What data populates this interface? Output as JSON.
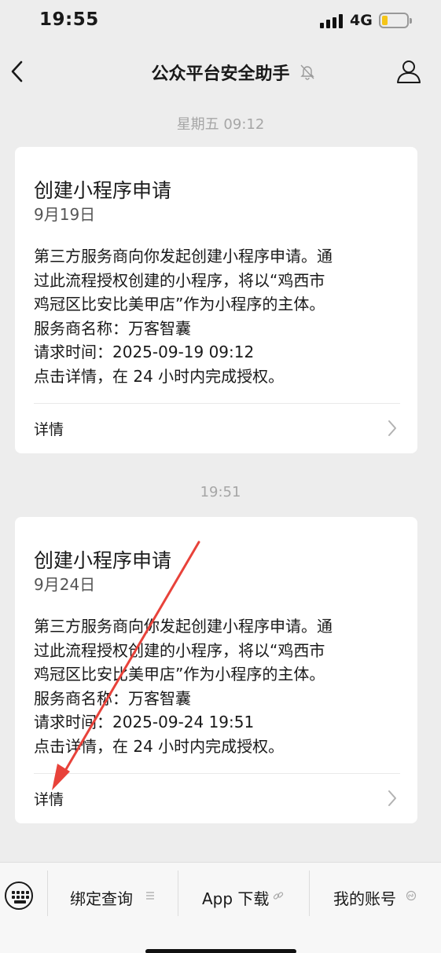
{
  "status_bar": {
    "time": "19:55",
    "network": "4G"
  },
  "nav": {
    "title": "公众平台安全助手"
  },
  "messages": [
    {
      "timestamp": "星期五 09:12",
      "title": "创建小程序申请",
      "date": "9月19日",
      "body_lines": [
        "第三方服务商向你发起创建小程序申请。通",
        "过此流程授权创建的小程序，将以“鸡西市",
        "鸡冠区比安比美甲店”作为小程序的主体。",
        "服务商名称：万客智囊",
        "请求时间：2025-09-19 09:12",
        "点击详情，在 24 小时内完成授权。"
      ],
      "detail_label": "详情"
    },
    {
      "timestamp": "19:51",
      "title": "创建小程序申请",
      "date": "9月24日",
      "body_lines": [
        "第三方服务商向你发起创建小程序申请。通",
        "过此流程授权创建的小程序，将以“鸡西市",
        "鸡冠区比安比美甲店”作为小程序的主体。",
        "服务商名称：万客智囊",
        "请求时间：2025-09-24 19:51",
        "点击详情，在 24 小时内完成授权。"
      ],
      "detail_label": "详情"
    }
  ],
  "bottom_menu": {
    "items": [
      {
        "label": "绑定查询",
        "icon": "list-icon"
      },
      {
        "label": "App 下载",
        "icon": "link-icon"
      },
      {
        "label": "我的账号",
        "icon": "mini-program-icon"
      }
    ]
  },
  "colors": {
    "background": "#ededed",
    "card": "#ffffff",
    "annotation_arrow": "#e8423a",
    "battery": "#f5c518"
  }
}
